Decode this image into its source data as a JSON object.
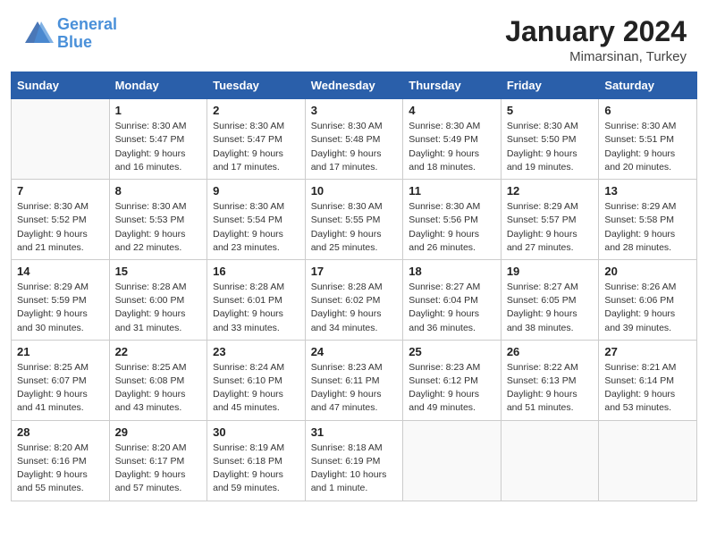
{
  "header": {
    "logo_line1": "General",
    "logo_line2": "Blue",
    "month_title": "January 2024",
    "location": "Mimarsinan, Turkey"
  },
  "weekdays": [
    "Sunday",
    "Monday",
    "Tuesday",
    "Wednesday",
    "Thursday",
    "Friday",
    "Saturday"
  ],
  "weeks": [
    [
      {
        "day": "",
        "info": ""
      },
      {
        "day": "1",
        "info": "Sunrise: 8:30 AM\nSunset: 5:47 PM\nDaylight: 9 hours\nand 16 minutes."
      },
      {
        "day": "2",
        "info": "Sunrise: 8:30 AM\nSunset: 5:47 PM\nDaylight: 9 hours\nand 17 minutes."
      },
      {
        "day": "3",
        "info": "Sunrise: 8:30 AM\nSunset: 5:48 PM\nDaylight: 9 hours\nand 17 minutes."
      },
      {
        "day": "4",
        "info": "Sunrise: 8:30 AM\nSunset: 5:49 PM\nDaylight: 9 hours\nand 18 minutes."
      },
      {
        "day": "5",
        "info": "Sunrise: 8:30 AM\nSunset: 5:50 PM\nDaylight: 9 hours\nand 19 minutes."
      },
      {
        "day": "6",
        "info": "Sunrise: 8:30 AM\nSunset: 5:51 PM\nDaylight: 9 hours\nand 20 minutes."
      }
    ],
    [
      {
        "day": "7",
        "info": "Sunrise: 8:30 AM\nSunset: 5:52 PM\nDaylight: 9 hours\nand 21 minutes."
      },
      {
        "day": "8",
        "info": "Sunrise: 8:30 AM\nSunset: 5:53 PM\nDaylight: 9 hours\nand 22 minutes."
      },
      {
        "day": "9",
        "info": "Sunrise: 8:30 AM\nSunset: 5:54 PM\nDaylight: 9 hours\nand 23 minutes."
      },
      {
        "day": "10",
        "info": "Sunrise: 8:30 AM\nSunset: 5:55 PM\nDaylight: 9 hours\nand 25 minutes."
      },
      {
        "day": "11",
        "info": "Sunrise: 8:30 AM\nSunset: 5:56 PM\nDaylight: 9 hours\nand 26 minutes."
      },
      {
        "day": "12",
        "info": "Sunrise: 8:29 AM\nSunset: 5:57 PM\nDaylight: 9 hours\nand 27 minutes."
      },
      {
        "day": "13",
        "info": "Sunrise: 8:29 AM\nSunset: 5:58 PM\nDaylight: 9 hours\nand 28 minutes."
      }
    ],
    [
      {
        "day": "14",
        "info": "Sunrise: 8:29 AM\nSunset: 5:59 PM\nDaylight: 9 hours\nand 30 minutes."
      },
      {
        "day": "15",
        "info": "Sunrise: 8:28 AM\nSunset: 6:00 PM\nDaylight: 9 hours\nand 31 minutes."
      },
      {
        "day": "16",
        "info": "Sunrise: 8:28 AM\nSunset: 6:01 PM\nDaylight: 9 hours\nand 33 minutes."
      },
      {
        "day": "17",
        "info": "Sunrise: 8:28 AM\nSunset: 6:02 PM\nDaylight: 9 hours\nand 34 minutes."
      },
      {
        "day": "18",
        "info": "Sunrise: 8:27 AM\nSunset: 6:04 PM\nDaylight: 9 hours\nand 36 minutes."
      },
      {
        "day": "19",
        "info": "Sunrise: 8:27 AM\nSunset: 6:05 PM\nDaylight: 9 hours\nand 38 minutes."
      },
      {
        "day": "20",
        "info": "Sunrise: 8:26 AM\nSunset: 6:06 PM\nDaylight: 9 hours\nand 39 minutes."
      }
    ],
    [
      {
        "day": "21",
        "info": "Sunrise: 8:25 AM\nSunset: 6:07 PM\nDaylight: 9 hours\nand 41 minutes."
      },
      {
        "day": "22",
        "info": "Sunrise: 8:25 AM\nSunset: 6:08 PM\nDaylight: 9 hours\nand 43 minutes."
      },
      {
        "day": "23",
        "info": "Sunrise: 8:24 AM\nSunset: 6:10 PM\nDaylight: 9 hours\nand 45 minutes."
      },
      {
        "day": "24",
        "info": "Sunrise: 8:23 AM\nSunset: 6:11 PM\nDaylight: 9 hours\nand 47 minutes."
      },
      {
        "day": "25",
        "info": "Sunrise: 8:23 AM\nSunset: 6:12 PM\nDaylight: 9 hours\nand 49 minutes."
      },
      {
        "day": "26",
        "info": "Sunrise: 8:22 AM\nSunset: 6:13 PM\nDaylight: 9 hours\nand 51 minutes."
      },
      {
        "day": "27",
        "info": "Sunrise: 8:21 AM\nSunset: 6:14 PM\nDaylight: 9 hours\nand 53 minutes."
      }
    ],
    [
      {
        "day": "28",
        "info": "Sunrise: 8:20 AM\nSunset: 6:16 PM\nDaylight: 9 hours\nand 55 minutes."
      },
      {
        "day": "29",
        "info": "Sunrise: 8:20 AM\nSunset: 6:17 PM\nDaylight: 9 hours\nand 57 minutes."
      },
      {
        "day": "30",
        "info": "Sunrise: 8:19 AM\nSunset: 6:18 PM\nDaylight: 9 hours\nand 59 minutes."
      },
      {
        "day": "31",
        "info": "Sunrise: 8:18 AM\nSunset: 6:19 PM\nDaylight: 10 hours\nand 1 minute."
      },
      {
        "day": "",
        "info": ""
      },
      {
        "day": "",
        "info": ""
      },
      {
        "day": "",
        "info": ""
      }
    ]
  ]
}
